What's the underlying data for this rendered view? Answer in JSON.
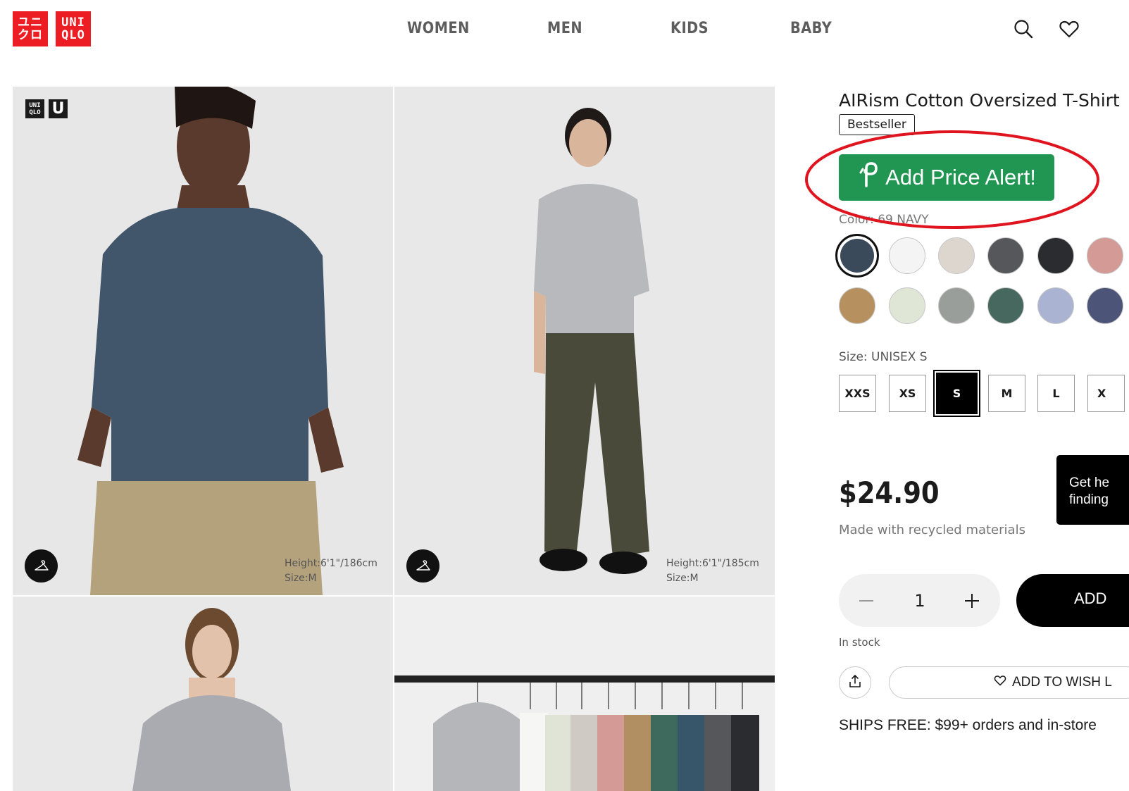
{
  "header": {
    "logo": {
      "line1": "ユニ",
      "line2": "クロ",
      "line3": "UNI",
      "line4": "QLO"
    },
    "nav": [
      "WOMEN",
      "MEN",
      "KIDS",
      "BABY"
    ],
    "brand_color": "#ed1d24"
  },
  "gallery": {
    "tile1": {
      "badge_line1": "UNI",
      "badge_line2": "QLO",
      "badge_u": "U",
      "model_height": "Height:6'1\"/186cm",
      "model_size": "Size:M"
    },
    "tile2": {
      "model_height": "Height:6'1\"/185cm",
      "model_size": "Size:M"
    }
  },
  "product": {
    "name": "AIRism Cotton Oversized T-Shirt",
    "badge": "Bestseller",
    "price_alert_label": "Add Price Alert!",
    "price_alert_color": "#219653",
    "color_label": "Color: 69 NAVY",
    "colors": [
      "#3a4a5a",
      "#f4f4f4",
      "#ddd6cf",
      "#55575a",
      "#2a2c30",
      "#d49a95",
      "#b6915f",
      "#dfe6d5",
      "#9a9e9a",
      "#46685f",
      "#aab4d2",
      "#4c5478"
    ],
    "selected_color": "#3a4a5a",
    "size_label": "Size: UNISEX S",
    "sizes": [
      "XXS",
      "XS",
      "S",
      "M",
      "L",
      "X"
    ],
    "selected_size": "S",
    "price": "$24.90",
    "material_note": "Made with recycled materials",
    "quantity": "1",
    "add_to_cart_label": "ADD",
    "stock_status": "In stock",
    "wishlist_label": "ADD TO WISH L",
    "shipping_note": "SHIPS FREE: $99+ orders and in-store"
  },
  "help_popup": {
    "line1": "Get he",
    "line2": "finding"
  },
  "annotation_color": "#e0141e",
  "icons": [
    "search-icon",
    "heart-icon",
    "hanger-icon",
    "price-tag-icon",
    "minus-icon",
    "plus-icon",
    "share-icon",
    "heart-outline-icon"
  ]
}
